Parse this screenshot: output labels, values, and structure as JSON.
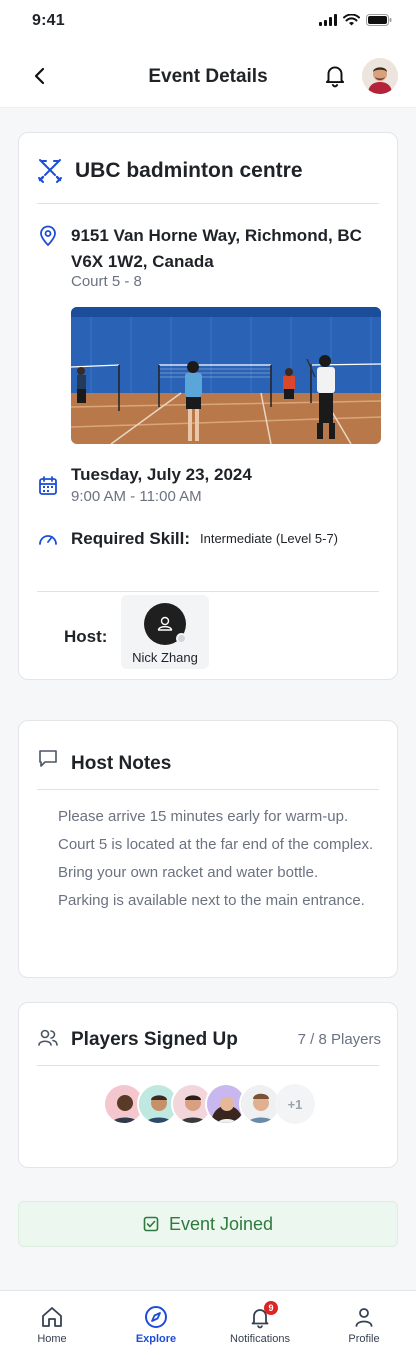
{
  "status_bar": {
    "time": "9:41"
  },
  "header": {
    "title": "Event Details"
  },
  "venue": {
    "name": "UBC badminton centre",
    "address": "9151 Van Horne Way, Richmond, BC V6X 1W2, Canada",
    "court": "Court 5 - 8",
    "date": "Tuesday, July 23, 2024",
    "time": "9:00 AM - 11:00 AM",
    "skill_label": "Required Skill:",
    "skill_value": "Intermediate (Level 5-7)",
    "host_label": "Host:",
    "host_name": "Nick Zhang"
  },
  "notes": {
    "title": "Host Notes",
    "items": [
      "Please arrive 15 minutes early for warm-up.",
      "Court 5 is located at the far end of the complex.",
      "Bring your own racket and water bottle.",
      "Parking is available next to the main entrance."
    ]
  },
  "players": {
    "title": "Players Signed Up",
    "count": "7 / 8 Players",
    "more": "+1"
  },
  "action": {
    "joined_label": "Event Joined"
  },
  "tabs": [
    {
      "label": "Home",
      "icon": "home-icon"
    },
    {
      "label": "Explore",
      "icon": "compass-icon",
      "active": true
    },
    {
      "label": "Notifications",
      "icon": "bell-icon",
      "badge": "9"
    },
    {
      "label": "Profile",
      "icon": "user-icon"
    }
  ],
  "colors": {
    "accent": "#1d4ed8",
    "success_bg": "#ecf8ef",
    "success_text": "#2f7a3e",
    "badge": "#dc2626"
  }
}
